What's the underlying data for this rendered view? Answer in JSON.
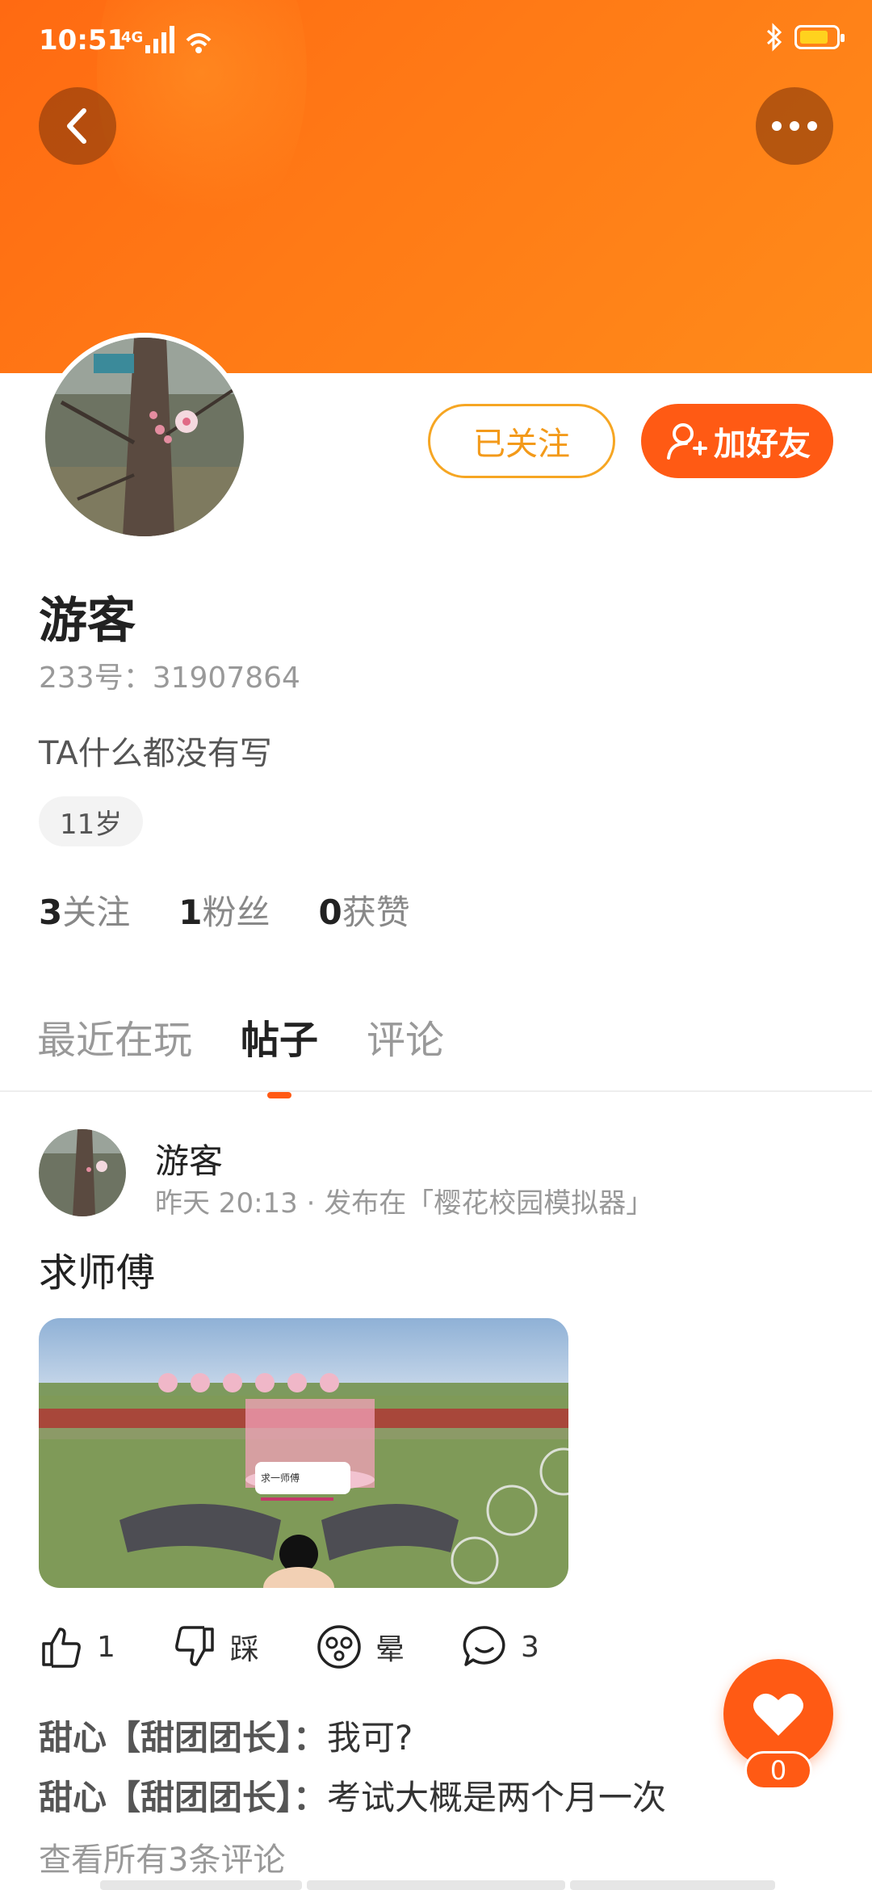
{
  "status_bar": {
    "time": "10:51",
    "network": "4G"
  },
  "profile": {
    "name": "游客",
    "uid": "233号：31907864",
    "bio": "TA什么都没有写",
    "age_tag": "11岁",
    "followed_label": "已关注",
    "add_friend_label": "加好友",
    "stats": [
      {
        "value": "3",
        "label": "关注"
      },
      {
        "value": "1",
        "label": "粉丝"
      },
      {
        "value": "0",
        "label": "获赞"
      }
    ]
  },
  "tabs": [
    {
      "label": "最近在玩",
      "active": false
    },
    {
      "label": "帖子",
      "active": true
    },
    {
      "label": "评论",
      "active": false
    }
  ],
  "post": {
    "author": "游客",
    "meta": "昨天 20:13 · 发布在「樱花校园模拟器」",
    "title": "求师傅",
    "image_caption": "求一师傅",
    "actions": {
      "like_count": "1",
      "dislike_label": "踩",
      "dizzy_label": "晕",
      "comment_count": "3"
    },
    "comments": [
      {
        "author": "甜心【甜团团长】：",
        "text": "我可?"
      },
      {
        "author": "甜心【甜团团长】：",
        "text": "考试大概是两个月一次"
      }
    ],
    "view_all": "查看所有3条评论"
  },
  "fab": {
    "count": "0"
  },
  "colors": {
    "accent": "#ff5a14",
    "followed_border": "#f6a623"
  }
}
